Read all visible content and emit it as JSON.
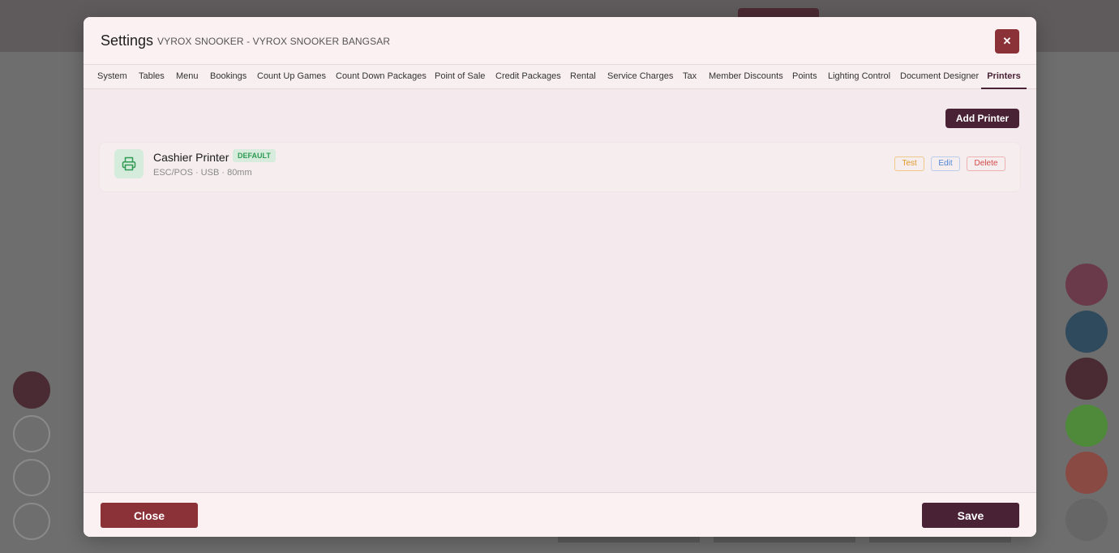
{
  "modal": {
    "title": "Settings",
    "subtitle": "VYROX SNOOKER - VYROX SNOOKER BANGSAR",
    "close_icon_glyph": "✕"
  },
  "tabs": [
    {
      "label": "System"
    },
    {
      "label": "Tables"
    },
    {
      "label": "Menu"
    },
    {
      "label": "Bookings"
    },
    {
      "label": "Count Up Games"
    },
    {
      "label": "Count Down Packages"
    },
    {
      "label": "Point of Sale"
    },
    {
      "label": "Credit Packages"
    },
    {
      "label": "Rental"
    },
    {
      "label": "Service Charges"
    },
    {
      "label": "Tax"
    },
    {
      "label": "Member Discounts"
    },
    {
      "label": "Points"
    },
    {
      "label": "Lighting Control"
    },
    {
      "label": "Document Designer"
    },
    {
      "label": "Printers",
      "active": true
    }
  ],
  "printers_panel": {
    "add_button_label": "Add Printer",
    "printers": [
      {
        "name": "Cashier Printer",
        "badge": "DEFAULT",
        "meta": "ESC/POS · USB · 80mm",
        "icon": "printer-icon",
        "actions": {
          "test": "Test",
          "edit": "Edit",
          "delete": "Delete"
        }
      }
    ]
  },
  "footer": {
    "close_label": "Close",
    "save_label": "Save"
  },
  "colors": {
    "primary": "#4a2235",
    "danger": "#8b3138",
    "badge_green": "#2e9a52",
    "test_orange": "#e09a2a",
    "edit_blue": "#4e86d6",
    "delete_red": "#d44a4a"
  }
}
